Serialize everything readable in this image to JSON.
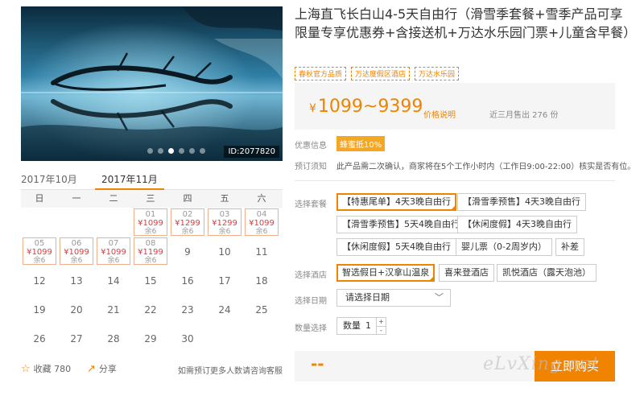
{
  "photo": {
    "id_label": "ID:2077820",
    "dots": [
      false,
      false,
      true,
      false,
      false,
      false
    ]
  },
  "calendar": {
    "tabs": [
      "2017年10月",
      "2017年11月"
    ],
    "weekdays": [
      "日",
      "一",
      "二",
      "三",
      "四",
      "五",
      "六"
    ],
    "days": {
      "1": {
        "day": "01",
        "price": "¥1099",
        "stock": "余6"
      },
      "2": {
        "day": "02",
        "price": "¥1299",
        "stock": "余6"
      },
      "3": {
        "day": "03",
        "price": "¥1299",
        "stock": "余6"
      },
      "4": {
        "day": "04",
        "price": "¥1099",
        "stock": "余6"
      },
      "5": {
        "day": "05",
        "price": "¥1099",
        "stock": "余6"
      },
      "6": {
        "day": "06",
        "price": "¥1099",
        "stock": "余6"
      },
      "7": {
        "day": "07",
        "price": "¥1099",
        "stock": "余6"
      },
      "8": {
        "day": "08",
        "price": "¥1199",
        "stock": "余6"
      },
      "9": "9",
      "10": "10",
      "11": "11",
      "12": "12",
      "13": "13",
      "14": "14",
      "15": "15",
      "16": "16",
      "17": "17",
      "18": "18",
      "19": "19",
      "20": "20",
      "21": "21",
      "22": "22",
      "23": "23",
      "24": "24",
      "25": "25",
      "26": "26",
      "27": "27",
      "28": "28",
      "29": "29",
      "30": "30"
    }
  },
  "actions": {
    "favorite": "收藏 780",
    "share": "分享",
    "note": "如需预订更多人数请咨询客服"
  },
  "product": {
    "title": "上海直飞长白山4-5天自由行（滑雪季套餐+雪季产品可享限量专享优惠券+含接送机+万达水乐园门票+儿童含早餐）",
    "tags": [
      "春秋官方品质",
      "万达度假区酒店",
      "万达水乐园"
    ],
    "price_currency": "¥",
    "price_range": "1099~9399",
    "price_link": "价格说明",
    "sold": "近三月售出 276 份"
  },
  "promo": {
    "label": "优惠信息",
    "badge": "蜂蜜抵10%"
  },
  "notice": {
    "label": "预订须知",
    "text": "此产品需二次确认，商家将在5个工作小时内（工作日9:00-22:00）核实是否有位。"
  },
  "package": {
    "label": "选择套餐",
    "options": [
      "【特惠尾单】4天3晚自由行",
      "【滑雪季预售】4天3晚自由行",
      "【滑雪季预售】5天4晚自由行",
      "【休闲度假】4天3晚自由行",
      "【休闲度假】5天4晚自由行",
      "婴儿票（0-2周岁内）",
      "补差"
    ]
  },
  "hotel": {
    "label": "选择酒店",
    "options": [
      "智选假日+汉拿山温泉",
      "喜来登酒店",
      "凯悦酒店（露天泡池）"
    ]
  },
  "date": {
    "label": "选择日期",
    "placeholder": "请选择日期",
    "chevron": "﹀"
  },
  "quantity": {
    "label": "数量选择",
    "field_label": "数量",
    "value": "1",
    "plus": "+",
    "minus": "-"
  },
  "buy": {
    "total": "--",
    "button": "立即购买"
  },
  "watermark": "eLvXing.net",
  "colors": {
    "accent": "#f08300",
    "price_red": "#e4393c",
    "badge": "#f5a623"
  }
}
